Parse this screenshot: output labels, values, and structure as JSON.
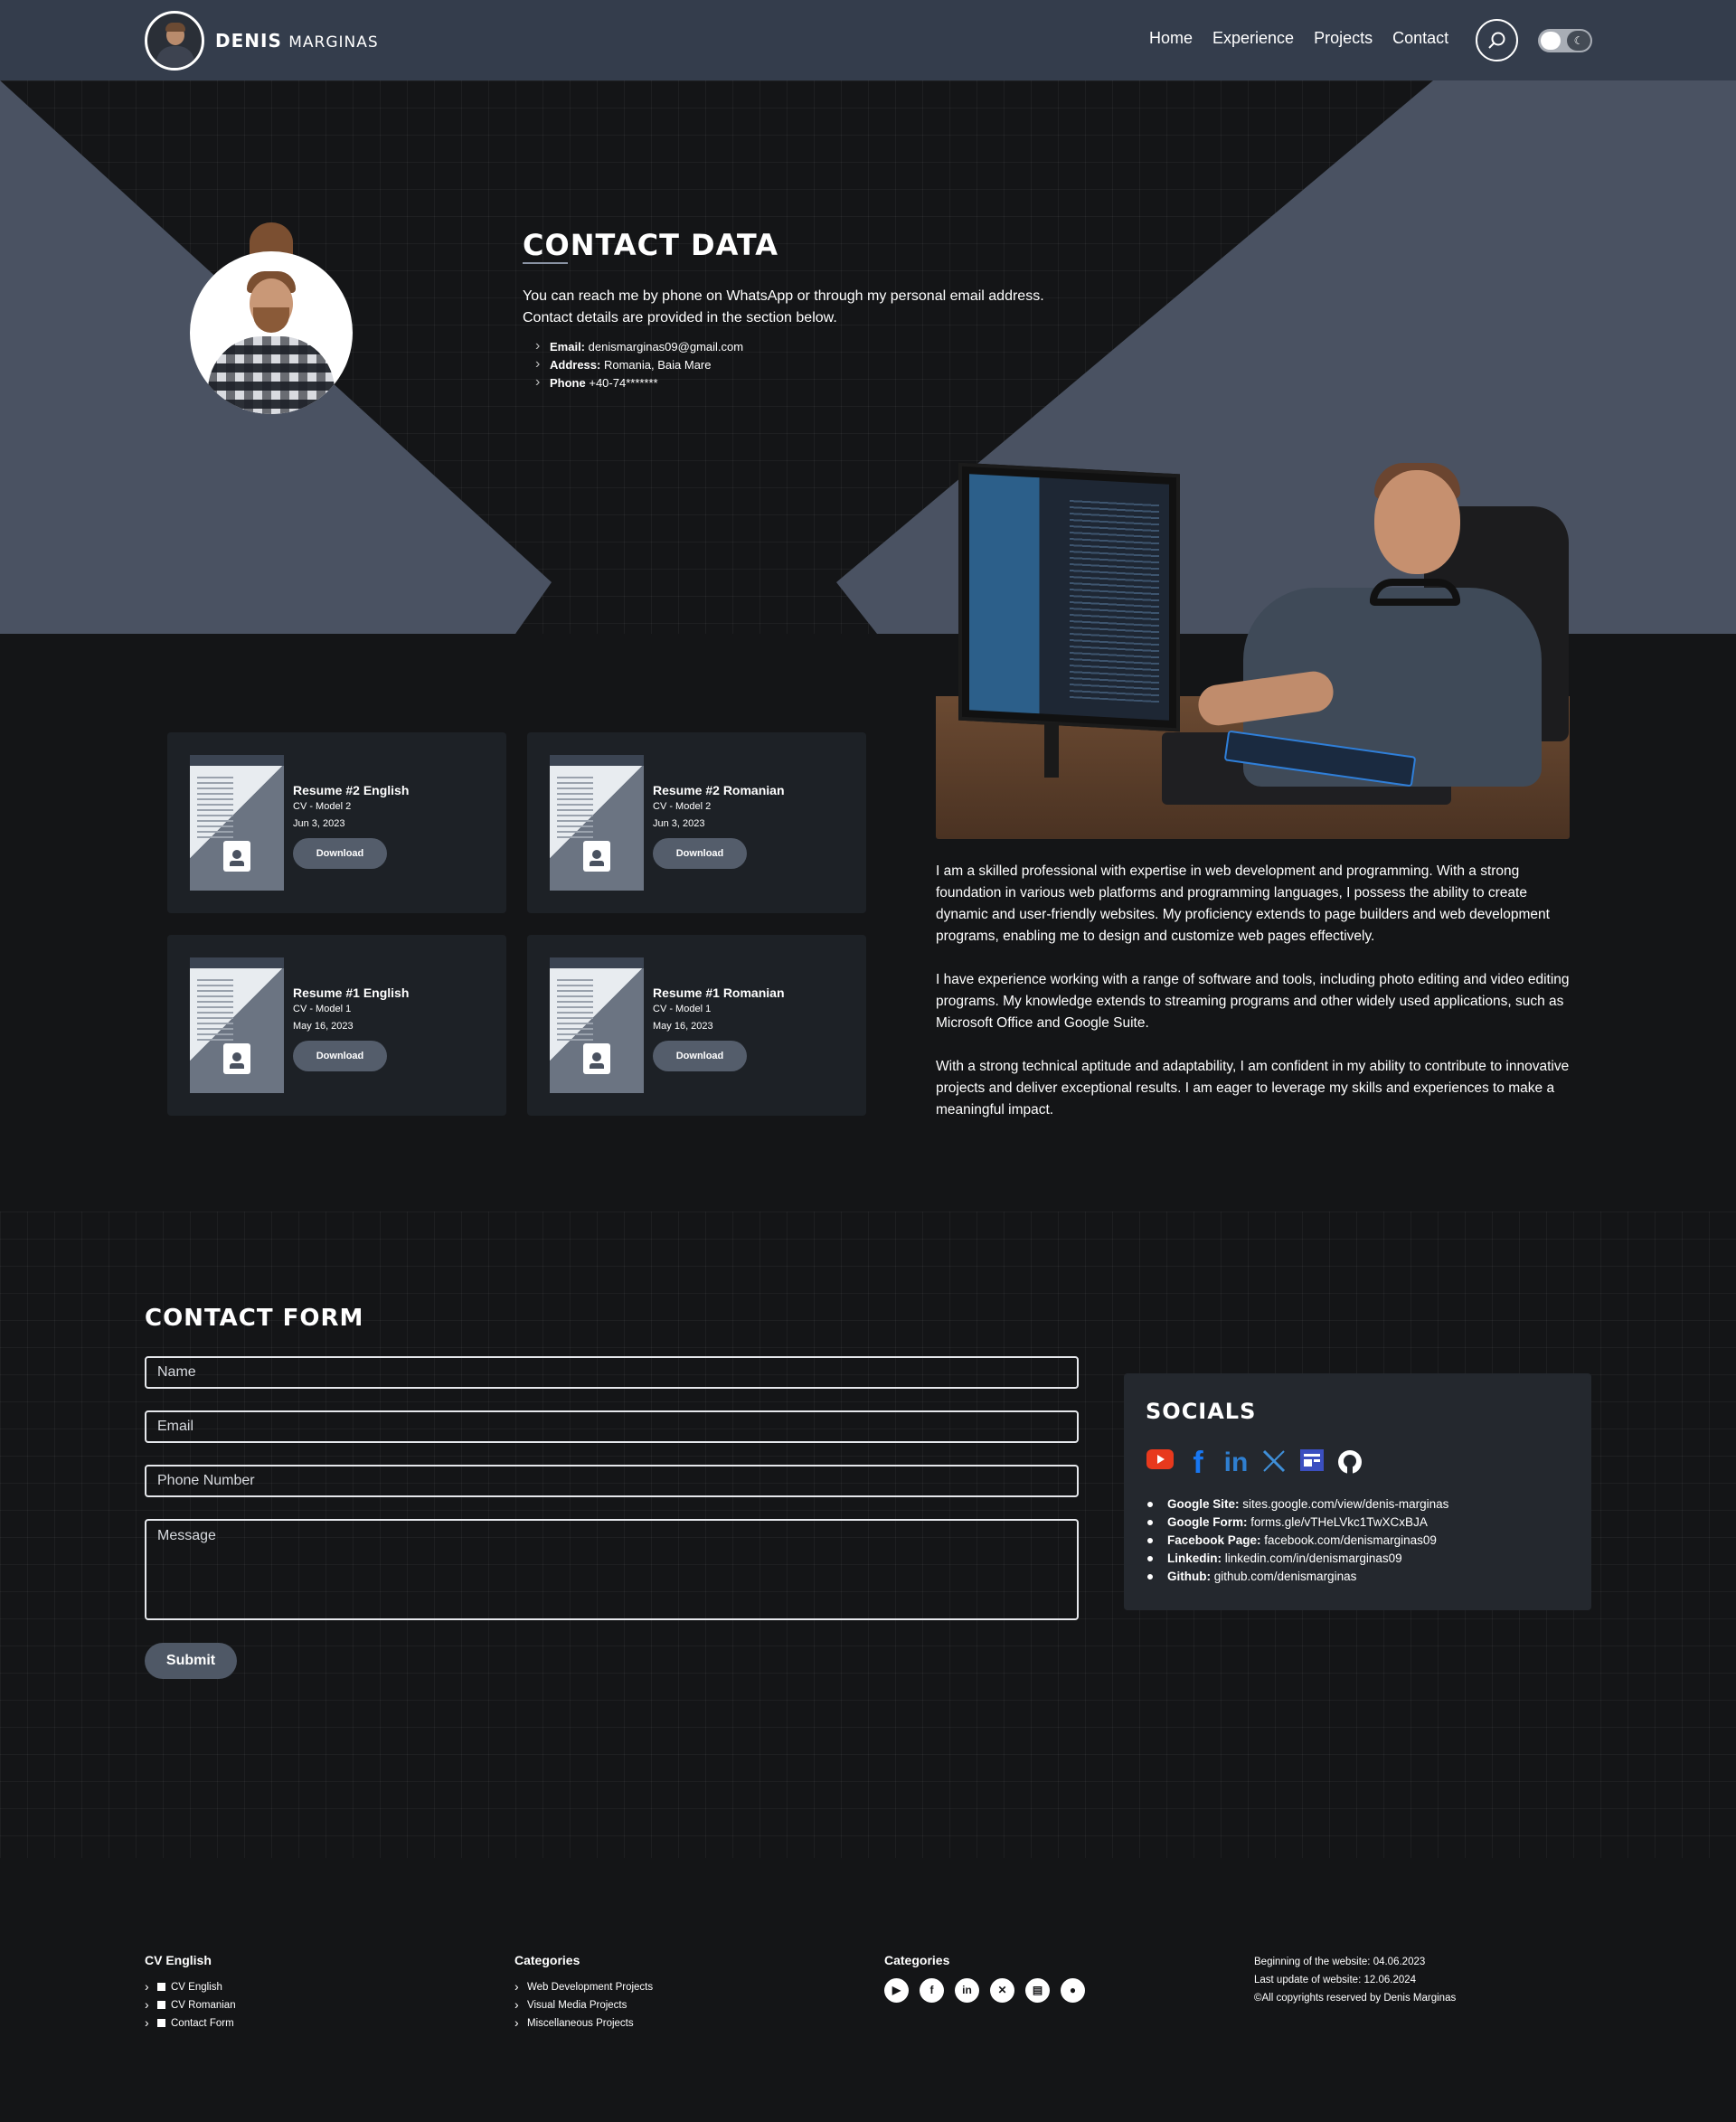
{
  "header": {
    "brand_bold": "Denis",
    "brand_rest": "Marginas",
    "nav": [
      "Home",
      "Experience",
      "Projects",
      "Contact"
    ]
  },
  "contact": {
    "title": "Contact Data",
    "intro": "You can reach me by phone on WhatsApp or through my personal email address. Contact details are provided in the section below.",
    "items": [
      {
        "label": "Email:",
        "value": "denismarginas09@gmail.com"
      },
      {
        "label": "Address:",
        "value": "Romania, Baia Mare"
      },
      {
        "label": "Phone",
        "value": "+40-74*******"
      }
    ]
  },
  "resumes": [
    {
      "title": "Resume #2 English",
      "model": "CV - Model 2",
      "date": "Jun 3, 2023",
      "button": "Download"
    },
    {
      "title": "Resume #2 Romanian",
      "model": "CV - Model 2",
      "date": "Jun 3, 2023",
      "button": "Download"
    },
    {
      "title": "Resume #1 English",
      "model": "CV - Model 1",
      "date": "May 16, 2023",
      "button": "Download"
    },
    {
      "title": "Resume #1 Romanian",
      "model": "CV - Model 1",
      "date": "May 16, 2023",
      "button": "Download"
    }
  ],
  "about": [
    "I am a skilled professional with expertise in web development and programming. With a strong foundation in various web platforms and programming languages, I possess the ability to create dynamic and user-friendly websites. My proficiency extends to page builders and web development programs, enabling me to design and customize web pages effectively.",
    "I have experience working with a range of software and tools, including photo editing and video editing programs. My knowledge extends to streaming programs and other widely used applications, such as Microsoft Office and Google Suite.",
    "With a strong technical aptitude and adaptability, I am confident in my ability to contribute to innovative projects and deliver exceptional results. I am eager to leverage my skills and experiences to make a meaningful impact."
  ],
  "form": {
    "title": "Contact Form",
    "name_placeholder": "Name",
    "email_placeholder": "Email",
    "phone_placeholder": "Phone Number",
    "message_placeholder": "Message",
    "submit": "Submit"
  },
  "socials": {
    "title": "Socials",
    "icons": [
      "youtube-icon",
      "facebook-icon",
      "linkedin-icon",
      "x-icon",
      "google-sites-icon",
      "github-icon"
    ],
    "links": [
      {
        "label": "Google Site:",
        "value": "sites.google.com/view/denis-marginas"
      },
      {
        "label": "Google Form:",
        "value": "forms.gle/vTHeLVkc1TwXCxBJA"
      },
      {
        "label": "Facebook Page:",
        "value": "facebook.com/denismarginas09"
      },
      {
        "label": "Linkedin:",
        "value": "linkedin.com/in/denismarginas09"
      },
      {
        "label": "Github:",
        "value": "github.com/denismarginas"
      }
    ]
  },
  "footer": {
    "col1": {
      "title": "CV English",
      "items": [
        "CV English",
        "CV Romanian",
        "Contact Form"
      ]
    },
    "col2": {
      "title": "Categories",
      "items": [
        "Web Development Projects",
        "Visual Media Projects",
        "Miscellaneous Projects"
      ]
    },
    "col3": {
      "title": "Categories"
    },
    "info": [
      "Beginning of the website: 04.06.2023",
      "Last update of website: 12.06.2024",
      "©All copyrights reserved by Denis Marginas"
    ]
  },
  "colors": {
    "header_bg": "#343d4c",
    "page_bg": "#141517",
    "card_bg": "#1d2126",
    "accent_shape": "#4a5262"
  }
}
